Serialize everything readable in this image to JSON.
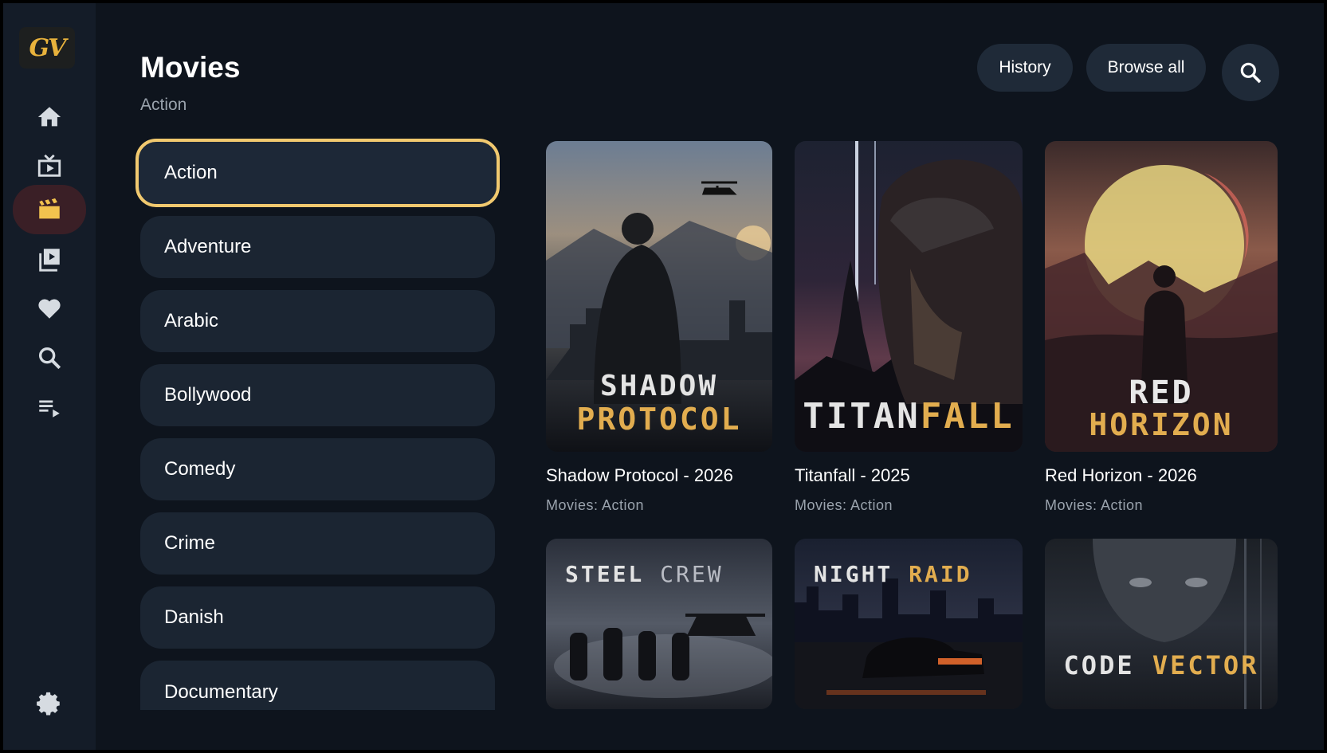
{
  "app": {
    "logo_text": "GV"
  },
  "nav_icons": [
    "home-icon",
    "live-tv-icon",
    "movies-icon",
    "series-icon",
    "favorites-icon",
    "search-icon",
    "playlist-icon",
    "settings-icon"
  ],
  "header": {
    "title": "Movies",
    "subtitle": "Action"
  },
  "toolbar": {
    "history_label": "History",
    "browse_all_label": "Browse all"
  },
  "categories": [
    "Action",
    "Adventure",
    "Arabic",
    "Bollywood",
    "Comedy",
    "Crime",
    "Danish",
    "Documentary"
  ],
  "selected_category": "Action",
  "movies": [
    {
      "poster_line1": "SHADOW",
      "poster_line2": "PROTOCOL",
      "title": "Shadow Protocol - 2026",
      "subtitle": "Movies: Action"
    },
    {
      "poster_line1": "TITAN",
      "poster_line2": "FALL",
      "title": "Titanfall - 2025",
      "subtitle": "Movies: Action"
    },
    {
      "poster_line1": "RED",
      "poster_line2": "HORIZON",
      "title": "Red Horizon - 2026",
      "subtitle": "Movies: Action"
    },
    {
      "poster_line1": "STEEL",
      "poster_line2": "CREW"
    },
    {
      "poster_line1": "NIGHT",
      "poster_line2": "RAID"
    },
    {
      "poster_line1": "CODE",
      "poster_line2": "VECTOR"
    }
  ],
  "colors": {
    "accent": "#f1c96f",
    "gold_text": "#e2ad4f",
    "background": "#0e141d",
    "rail": "#141c28",
    "active_nav": "#3a1f26"
  }
}
